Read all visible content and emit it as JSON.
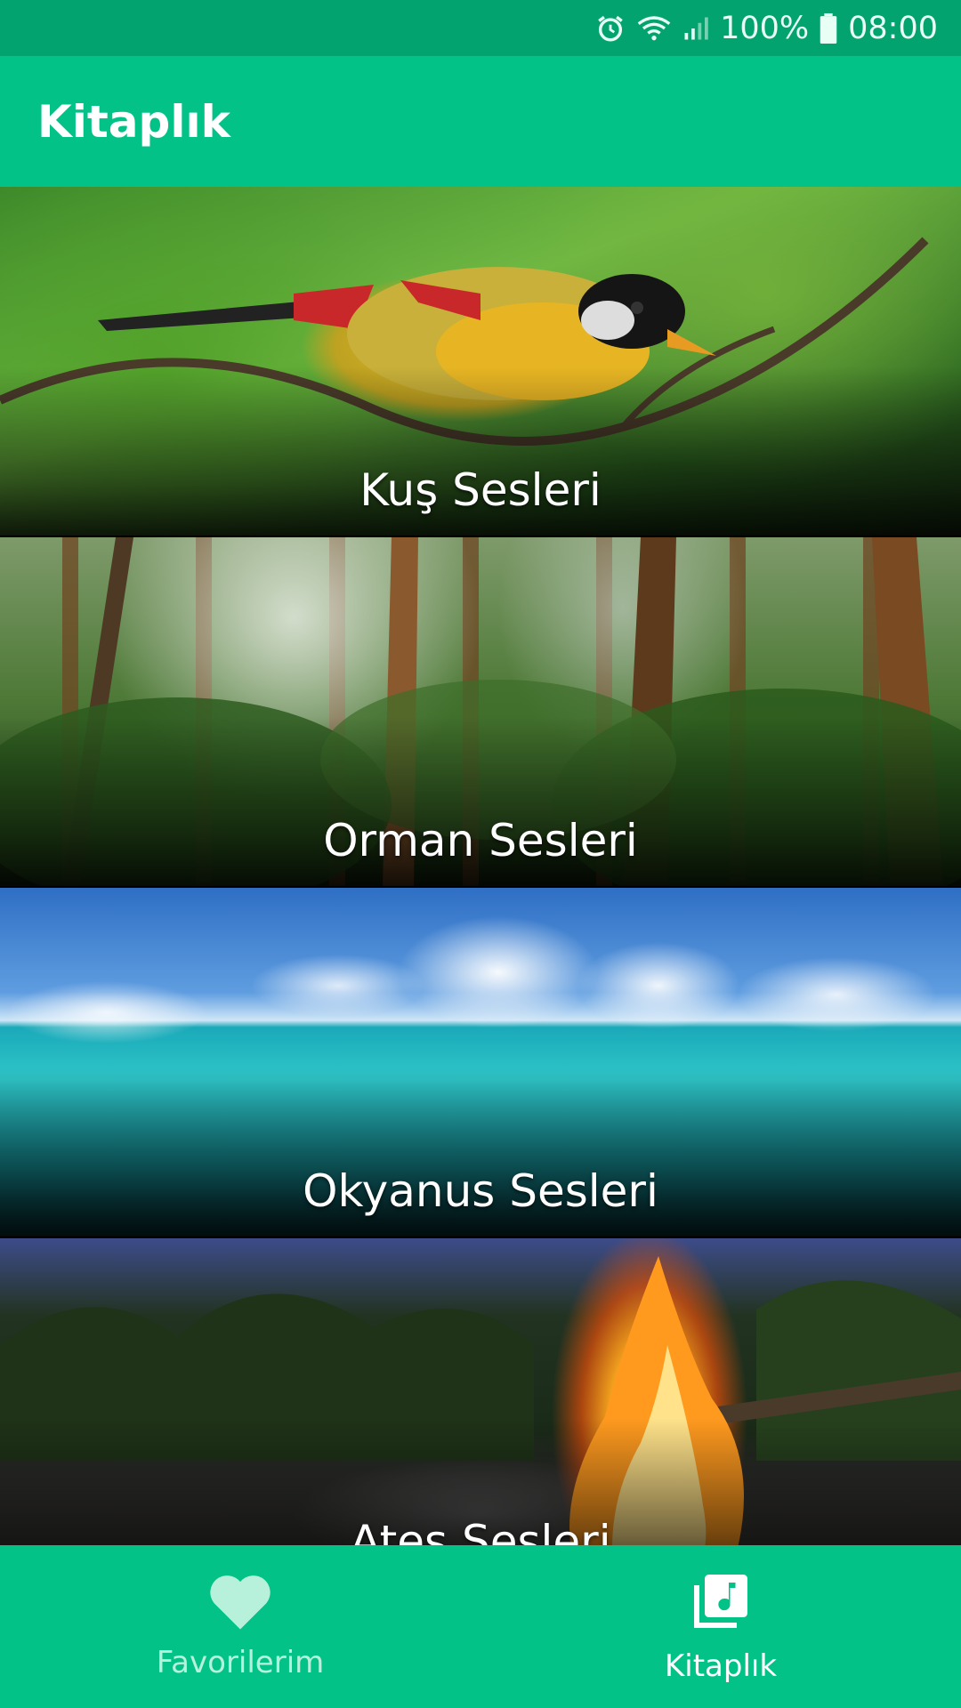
{
  "status_bar": {
    "battery": "100%",
    "time": "08:00",
    "icons": [
      "alarm-icon",
      "wifi-icon",
      "signal-icon",
      "battery-icon"
    ]
  },
  "app_bar": {
    "title": "Kitaplık"
  },
  "library": {
    "items": [
      {
        "label": "Kuş Sesleri"
      },
      {
        "label": "Orman Sesleri"
      },
      {
        "label": "Okyanus Sesleri"
      },
      {
        "label": "Ateş Sesleri"
      }
    ]
  },
  "bottom_nav": {
    "items": [
      {
        "label": "Favorilerim",
        "icon": "heart-icon",
        "active": false
      },
      {
        "label": "Kitaplık",
        "icon": "music-library-icon",
        "active": true
      }
    ]
  },
  "colors": {
    "status_bar": "#02a36e",
    "primary": "#03c287",
    "inactive_nav": "#b8f1db",
    "text_on_primary": "#ffffff"
  }
}
